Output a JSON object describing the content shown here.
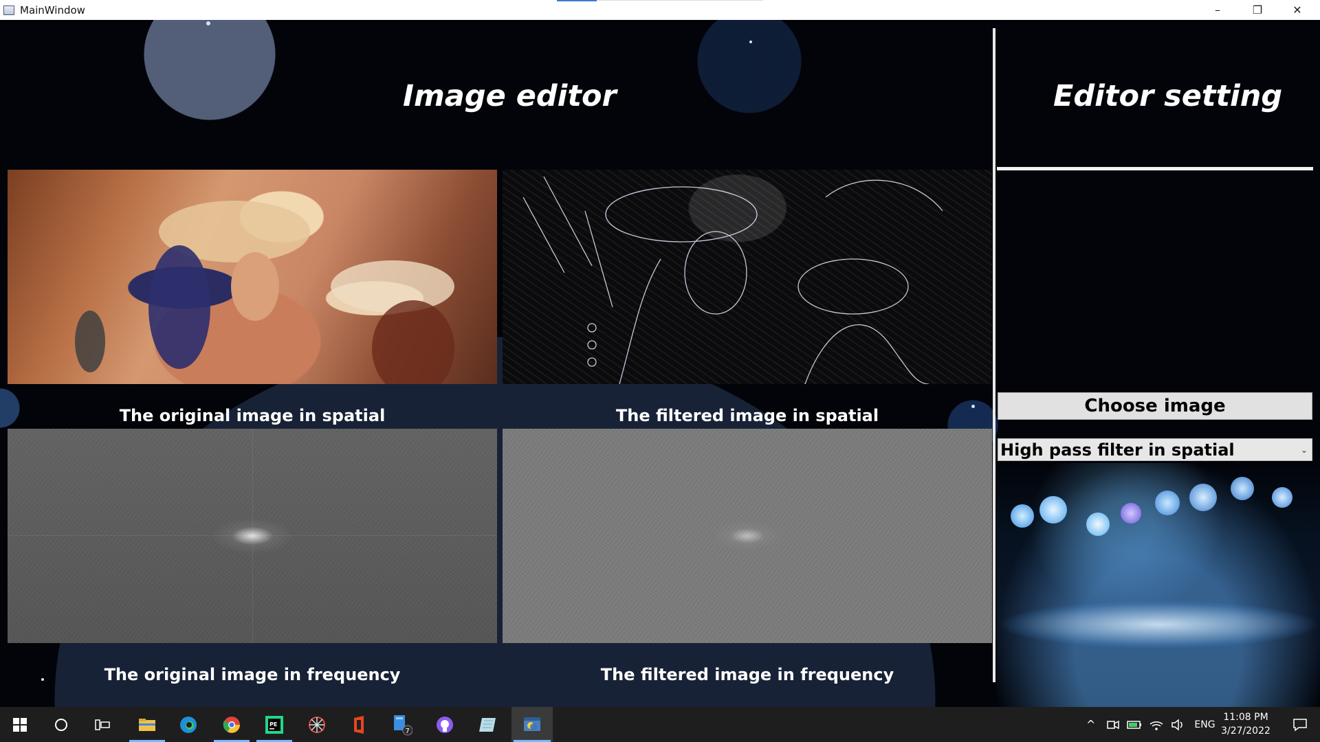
{
  "window": {
    "title": "MainWindow",
    "min": "–",
    "restore": "❐",
    "close": "✕"
  },
  "main": {
    "heading": "Image editor",
    "panels": [
      {
        "caption": "The original image in spatial"
      },
      {
        "caption": "The filtered image in spatial"
      },
      {
        "caption": "The original image in frequency"
      },
      {
        "caption": "The filtered image in frequency"
      }
    ]
  },
  "settings": {
    "heading": "Editor setting",
    "choose_button": "Choose image",
    "filter_select": {
      "value": "High pass filter in spatial",
      "chevron": "⌄"
    }
  },
  "taskbar": {
    "apps": [
      {
        "icon": "start-icon",
        "glyph": "⊞"
      },
      {
        "icon": "search-circle-icon",
        "glyph": "○"
      },
      {
        "icon": "task-view-icon",
        "glyph": "⧉"
      },
      {
        "icon": "file-explorer-icon",
        "glyph": "▬"
      },
      {
        "icon": "edge-icon",
        "glyph": "◉"
      },
      {
        "icon": "chrome-icon",
        "glyph": "◎"
      },
      {
        "icon": "pycharm-icon",
        "glyph": "PE"
      },
      {
        "icon": "network-app-icon",
        "glyph": "✲"
      },
      {
        "icon": "office-icon",
        "glyph": "◧"
      },
      {
        "icon": "files-badge-icon",
        "glyph": "▮",
        "badge": "7"
      },
      {
        "icon": "github-icon",
        "glyph": "●"
      },
      {
        "icon": "notes-icon",
        "glyph": "◆"
      },
      {
        "icon": "python-app-icon",
        "glyph": "▣"
      }
    ],
    "tray": {
      "chevron": "^",
      "language": "ENG"
    },
    "clock": {
      "time": "11:08 PM",
      "date": "3/27/2022"
    }
  },
  "colors": {
    "accent": "#7ab8ff",
    "button_bg": "#e1e1e1",
    "background": "#020409"
  }
}
